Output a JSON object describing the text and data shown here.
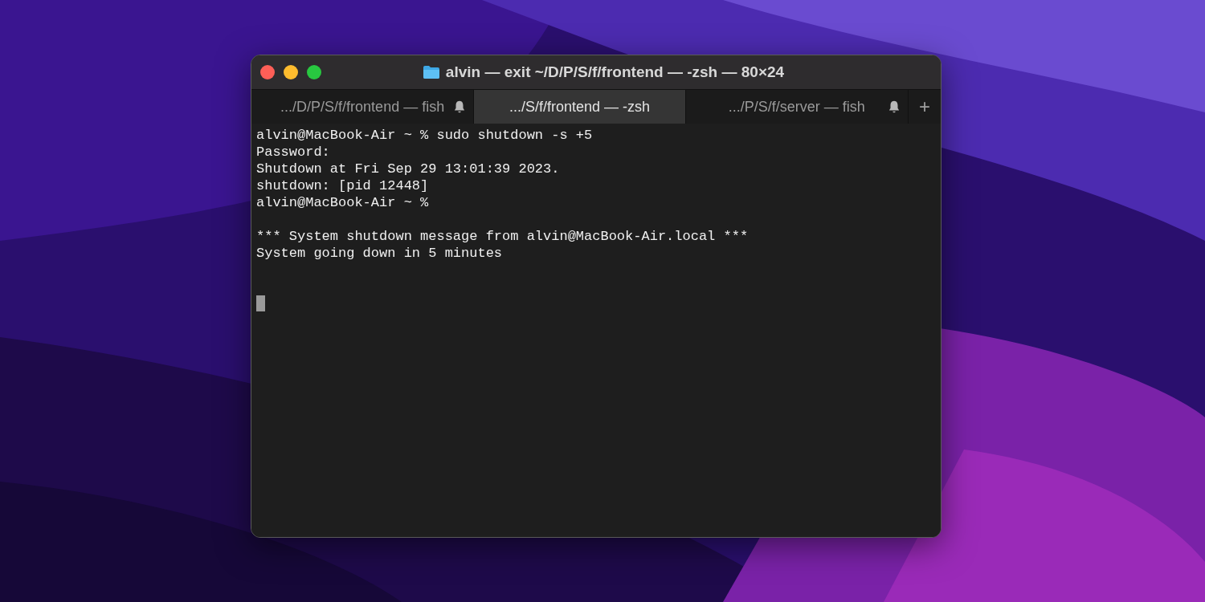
{
  "window": {
    "title": "alvin — exit ~/D/P/S/f/frontend — -zsh — 80×24"
  },
  "tabs": [
    {
      "label": ".../D/P/S/f/frontend — fish",
      "selected": false,
      "bell": true
    },
    {
      "label": ".../S/f/frontend — -zsh",
      "selected": true,
      "bell": false
    },
    {
      "label": ".../P/S/f/server — fish",
      "selected": false,
      "bell": true
    }
  ],
  "new_tab_button": "+",
  "terminal_lines": [
    {
      "kind": "text",
      "text": "alvin@MacBook-Air ~ % sudo shutdown -s +5"
    },
    {
      "kind": "text",
      "text": "Password:"
    },
    {
      "kind": "text",
      "text": "Shutdown at Fri Sep 29 13:01:39 2023."
    },
    {
      "kind": "text",
      "text": "shutdown: [pid 12448]"
    },
    {
      "kind": "text",
      "text": "alvin@MacBook-Air ~ %"
    },
    {
      "kind": "blank"
    },
    {
      "kind": "text",
      "text": "*** System shutdown message from alvin@MacBook-Air.local ***"
    },
    {
      "kind": "text",
      "text": "System going down in 5 minutes"
    },
    {
      "kind": "blank"
    },
    {
      "kind": "blank"
    },
    {
      "kind": "cursor"
    }
  ]
}
